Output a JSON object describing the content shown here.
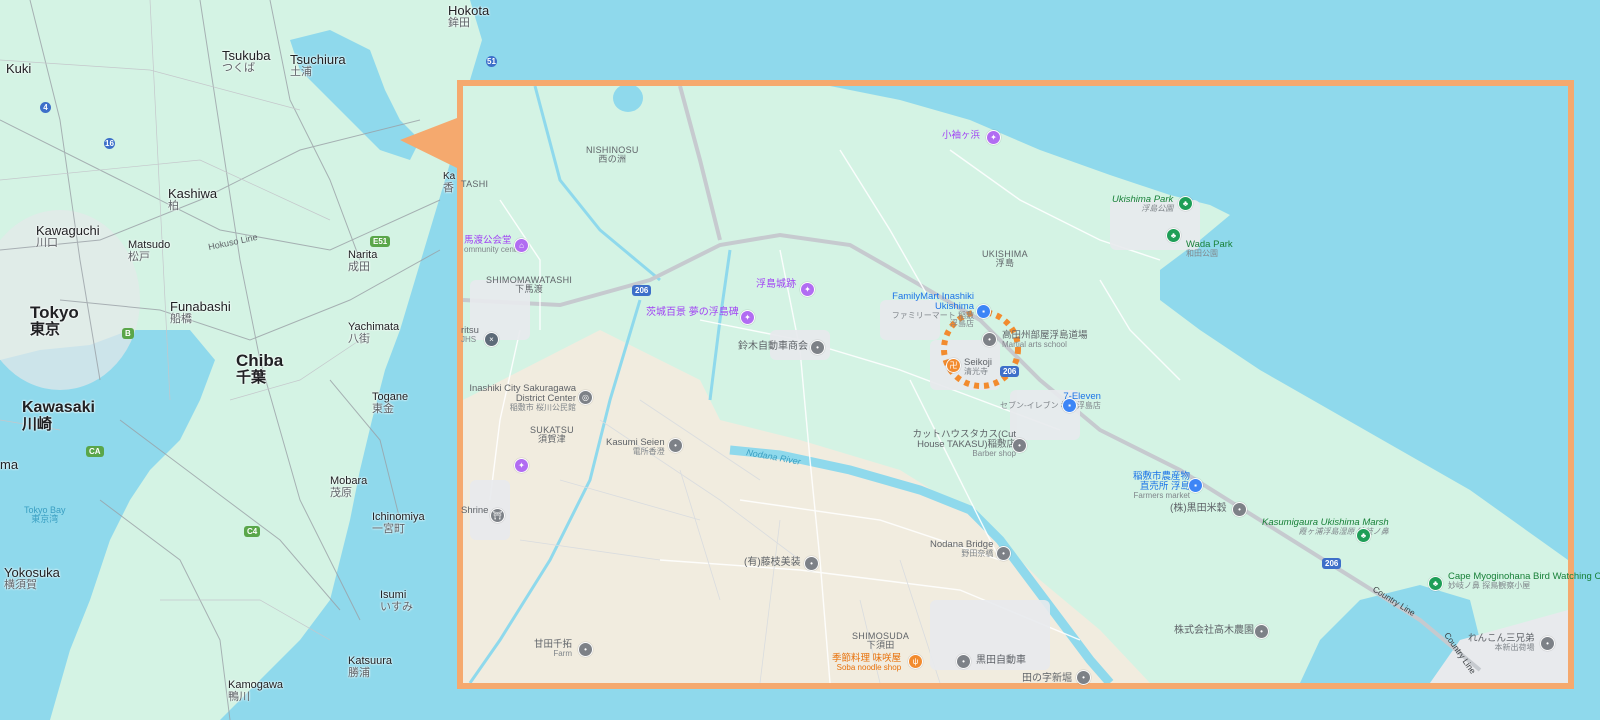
{
  "overview": {
    "places": [
      {
        "id": "hokota",
        "name": "Hokota",
        "jp": "鉾田"
      },
      {
        "id": "tsukuba",
        "name": "Tsukuba",
        "jp": "つくば"
      },
      {
        "id": "tsuchiura",
        "name": "Tsuchiura",
        "jp": "土浦"
      },
      {
        "id": "kuki",
        "name": "Kuki",
        "jp": ""
      },
      {
        "id": "kashiwa",
        "name": "Kashiwa",
        "jp": "柏"
      },
      {
        "id": "kawaguchi",
        "name": "Kawaguchi",
        "jp": "川口"
      },
      {
        "id": "matsudo",
        "name": "Matsudo",
        "jp": "松戸"
      },
      {
        "id": "narita",
        "name": "Narita",
        "jp": "成田"
      },
      {
        "id": "tokyo",
        "name": "Tokyo",
        "jp": "東京"
      },
      {
        "id": "funabashi",
        "name": "Funabashi",
        "jp": "船橋"
      },
      {
        "id": "chiba",
        "name": "Chiba",
        "jp": "千葉"
      },
      {
        "id": "yachimata",
        "name": "Yachimata",
        "jp": "八街"
      },
      {
        "id": "kawasaki",
        "name": "Kawasaki",
        "jp": "川崎"
      },
      {
        "id": "togane",
        "name": "Togane",
        "jp": "東金"
      },
      {
        "id": "mobara",
        "name": "Mobara",
        "jp": "茂原"
      },
      {
        "id": "ichinomiya",
        "name": "Ichinomiya",
        "jp": "一宮町"
      },
      {
        "id": "yokosuka",
        "name": "Yokosuka",
        "jp": "横須賀"
      },
      {
        "id": "isumi",
        "name": "Isumi",
        "jp": "いすみ"
      },
      {
        "id": "katsuura",
        "name": "Katsuura",
        "jp": "勝浦"
      },
      {
        "id": "kamogawa",
        "name": "Kamogawa",
        "jp": "鴨川"
      },
      {
        "id": "ma",
        "name": "ma",
        "jp": ""
      },
      {
        "id": "tokyobay",
        "name": "Tokyo Bay",
        "jp": "東京湾"
      },
      {
        "id": "ka",
        "name": "Ka",
        "jp": "香"
      }
    ],
    "line_label": "Hokuso Line",
    "shields": [
      "51",
      "4",
      "16",
      "E51",
      "B",
      "CA",
      "C4"
    ]
  },
  "detail": {
    "areas": [
      {
        "id": "nishinosu",
        "name": "NISHINOSU",
        "jp": "西の洲"
      },
      {
        "id": "shimomawatashi",
        "name": "SHIMOMAWATASHI",
        "jp": "下馬渡"
      },
      {
        "id": "ukishima",
        "name": "UKISHIMA",
        "jp": "浮島"
      },
      {
        "id": "sukatsu",
        "name": "SUKATSU",
        "jp": "須賀津"
      },
      {
        "id": "shimosuda",
        "name": "SHIMOSUDA",
        "jp": "下須田"
      },
      {
        "id": "tashi",
        "name": "TASHI",
        "jp": ""
      }
    ],
    "pois": [
      {
        "id": "komezu",
        "name": "小袖ヶ浜",
        "sub": "",
        "color": "purple"
      },
      {
        "id": "ukishima-park",
        "name": "Ukishima Park",
        "sub": "浮島公園",
        "color": "green"
      },
      {
        "id": "wada-park",
        "name": "Wada Park",
        "sub": "和田公園",
        "color": "green"
      },
      {
        "id": "community",
        "name": "馬渡公会堂",
        "sub": "ommunity center",
        "color": "purple"
      },
      {
        "id": "ukishima-castle",
        "name": "浮島城跡",
        "sub": "",
        "color": "purple"
      },
      {
        "id": "yumenoukishima",
        "name": "茨城百景 夢の浮島碑",
        "sub": "",
        "color": "purple"
      },
      {
        "id": "familymart",
        "name": "FamilyMart Inashiki Ukishima",
        "sub": "ファミリーマート 稲敷浮島店",
        "color": "blue"
      },
      {
        "id": "takada",
        "name": "高田州部屋浮島道場",
        "sub": "Martial arts school",
        "color": "gray"
      },
      {
        "id": "seikoji",
        "name": "Seikoji",
        "sub": "清光寺",
        "color": "gray"
      },
      {
        "id": "suzuki",
        "name": "鈴木自動車商会",
        "sub": "",
        "color": "gray"
      },
      {
        "id": "ritsu",
        "name": "ritsu",
        "sub": "JHS",
        "color": "gray"
      },
      {
        "id": "sakuragawa",
        "name": "Inashiki City Sakuragawa District Center",
        "sub": "稲敷市 桜川公民館",
        "color": "gray"
      },
      {
        "id": "seven",
        "name": "7-Eleven",
        "sub": "セブン-イレブン 桜川浮島店",
        "color": "blue"
      },
      {
        "id": "cuthouse",
        "name": "カットハウスタカス(Cut House TAKASU)稲敷店",
        "sub": "Barber shop",
        "color": "gray"
      },
      {
        "id": "kasumi",
        "name": "Kasumi Seien",
        "sub": "電所香澄",
        "color": "gray"
      },
      {
        "id": "farmers",
        "name": "稲敷市農産物 直売所 浮島",
        "sub": "Farmers market",
        "color": "blue"
      },
      {
        "id": "kuroda-rice",
        "name": "(株)黒田米穀",
        "sub": "",
        "color": "gray"
      },
      {
        "id": "kasumigaura-marsh",
        "name": "Kasumigaura Ukishima Marsh",
        "sub": "霞ヶ浦浮島湿原 妙岐ノ鼻",
        "color": "green"
      },
      {
        "id": "shrine",
        "name": "Shrine",
        "sub": "",
        "color": "gray"
      },
      {
        "id": "nodana-bridge",
        "name": "Nodana Bridge",
        "sub": "野田奈橋",
        "color": "gray"
      },
      {
        "id": "fujieda",
        "name": "(有)藤枝美装",
        "sub": "",
        "color": "gray"
      },
      {
        "id": "myogi",
        "name": "Cape Myoginohana Bird Watching Cabin",
        "sub": "妙岐ノ鼻 探鳥観察小屋",
        "color": "green"
      },
      {
        "id": "takagi",
        "name": "株式会社高木農園",
        "sub": "",
        "color": "gray"
      },
      {
        "id": "amata",
        "name": "甘田千拓",
        "sub": "Farm",
        "color": "gray"
      },
      {
        "id": "soba",
        "name": "季節料理 味咲屋",
        "sub": "Soba noodle shop",
        "color": "orange"
      },
      {
        "id": "kuroda-auto",
        "name": "黒田自動車",
        "sub": "",
        "color": "gray"
      },
      {
        "id": "renkon",
        "name": "れんこん三兄弟",
        "sub": "本新出荷場",
        "color": "gray"
      },
      {
        "id": "tanoji",
        "name": "田の字新堀",
        "sub": "",
        "color": "gray"
      }
    ],
    "river": "Nodana River",
    "road": "Country Line",
    "route": "206"
  },
  "colors": {
    "water": "#8fd9ec",
    "land": "#d4f3e4",
    "farmland": "#f1ecdf",
    "inset_border": "#f5a96e",
    "marker": "#f28b2e"
  }
}
